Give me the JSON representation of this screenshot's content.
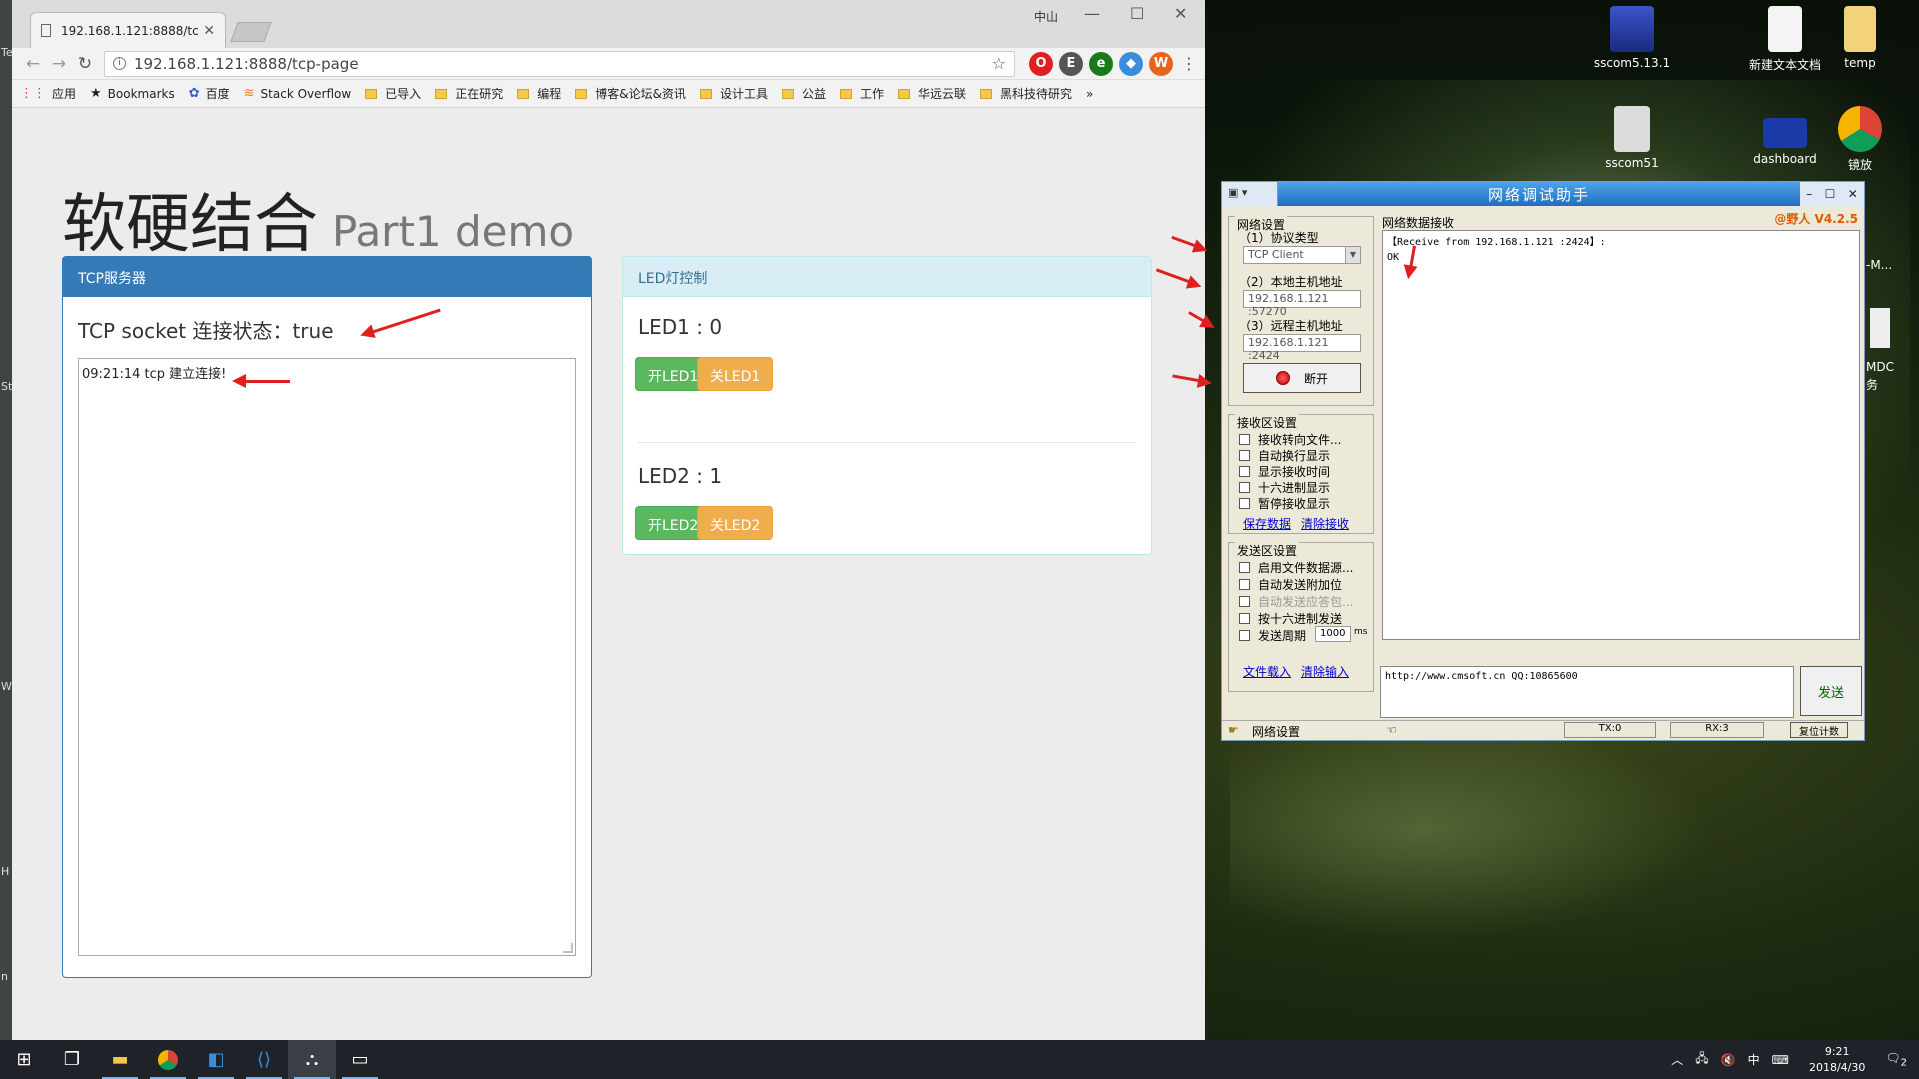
{
  "browser": {
    "tab_title": "192.168.1.121:8888/tc",
    "url": "192.168.1.121:8888/tcp-page",
    "profile": "中山",
    "bookmarks": [
      "应用",
      "Bookmarks",
      "百度",
      "Stack Overflow",
      "已导入",
      "正在研究",
      "编程",
      "博客&论坛&资讯",
      "设计工具",
      "公益",
      "工作",
      "华远云联",
      "黑科技待研究"
    ],
    "more": "»"
  },
  "page": {
    "title": "软硬结合",
    "subtitle": "Part1 demo",
    "tcp_panel": {
      "heading": "TCP服务器",
      "status": "TCP socket 连接状态：true",
      "log": "09:21:14  tcp 建立连接!"
    },
    "led_panel": {
      "heading": "LED灯控制",
      "led1": {
        "label": "LED1 : 0",
        "on": "开LED1",
        "off": "关LED1"
      },
      "led2": {
        "label": "LED2 : 1",
        "on": "开LED2",
        "off": "关LED2"
      }
    }
  },
  "desktop": {
    "icons": [
      "sscom5.13.1",
      "新建文本文档",
      "temp",
      "sscom51",
      "dashboard",
      "镜放"
    ],
    "partial_left": [
      "Te",
      "St",
      "W",
      "H",
      "n"
    ],
    "partial_right": [
      "-M...",
      "MDC",
      "务"
    ]
  },
  "netassist": {
    "title": "网络调试助手",
    "menu": "▾",
    "brand": "@野人 V4.2.5",
    "net_settings": "网络设置",
    "protocol_label": "（1）协议类型",
    "protocol": "TCP Client",
    "local_label": "（2）本地主机地址",
    "local": "192.168.1.121 :57270",
    "remote_label": "（3）远程主机地址",
    "remote": "192.168.1.121 :2424",
    "disconnect": "断开",
    "recv_settings": "接收区设置",
    "recv_opts": [
      "接收转向文件...",
      "自动换行显示",
      "显示接收时间",
      "十六进制显示",
      "暂停接收显示"
    ],
    "save_data": "保存数据",
    "clear_recv": "清除接收",
    "send_settings": "发送区设置",
    "send_opts": [
      "启用文件数据源...",
      "自动发送附加位",
      "自动发送应答包...",
      "按十六进制发送",
      "发送周期"
    ],
    "period": "1000",
    "ms": "ms",
    "load_file": "文件载入",
    "clear_input": "清除输入",
    "recv_title": "网络数据接收",
    "recv_line1": "【Receive from 192.168.1.121 :2424】:",
    "recv_line2": "OK",
    "send_text": "http://www.cmsoft.cn QQ:10865600",
    "send_btn": "发送",
    "status_label": "网络设置",
    "tx": "TX:0",
    "rx": "RX:3",
    "reset": "复位计数"
  },
  "taskbar": {
    "time": "9:21",
    "date": "2018/4/30",
    "ime": "中",
    "notif": "2"
  }
}
